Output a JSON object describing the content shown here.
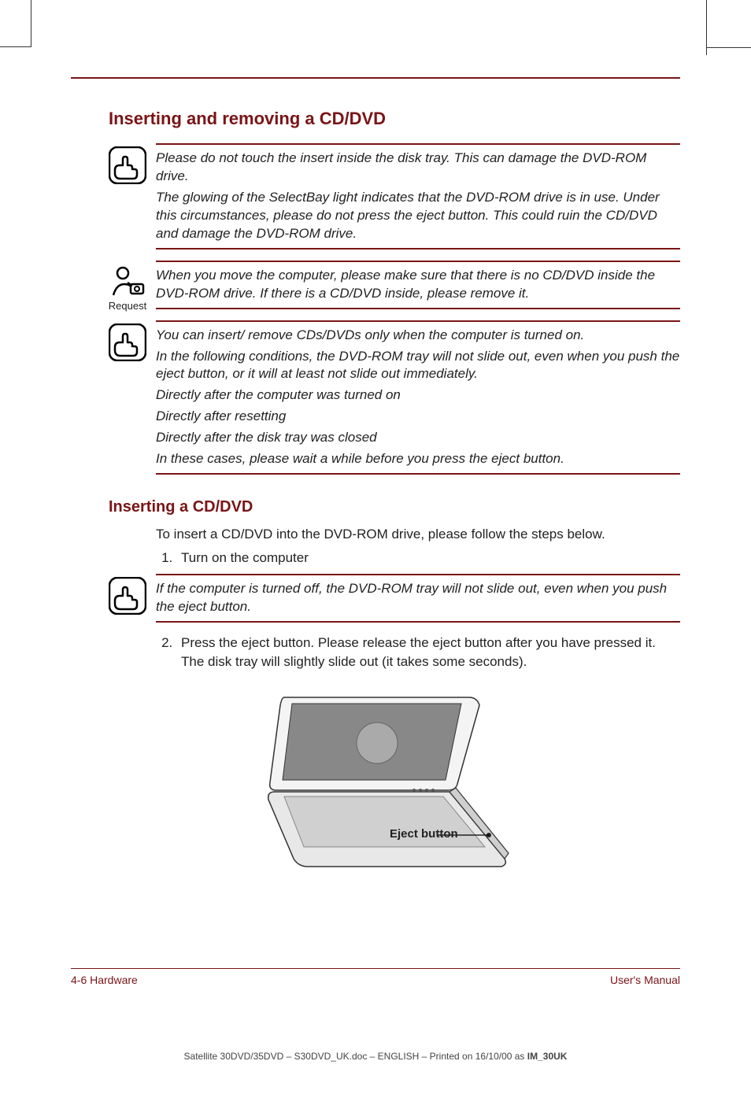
{
  "section": {
    "title_1": "Inserting and removing a CD/DVD",
    "title_2": "Inserting a CD/DVD"
  },
  "callouts": {
    "c1": {
      "p1": "Please do not touch the insert inside the disk tray. This can damage the DVD-ROM drive.",
      "p2": "The glowing of the SelectBay light indicates that the DVD-ROM drive is in use. Under this circumstances, please do not press the eject button. This could ruin the CD/DVD and damage the DVD-ROM drive."
    },
    "c2": {
      "label": "Request",
      "p1": "When you move the computer, please make sure that there is no CD/DVD inside the DVD-ROM drive. If there is a CD/DVD inside, please remove it."
    },
    "c3": {
      "p1": "You can insert/ remove CDs/DVDs only when the computer is turned on.",
      "p2": "In the following conditions, the DVD-ROM tray will not slide out, even when you push the eject button, or it will at least not slide out immediately.",
      "p3": "Directly after the computer was turned on",
      "p4": "Directly after resetting",
      "p5": "Directly after the disk tray was closed",
      "p6": "In these cases, please wait a while before you press the eject button."
    },
    "c4": {
      "p1": "If the computer is turned off, the DVD-ROM tray will not slide out, even when you push the eject button."
    }
  },
  "body": {
    "intro": "To insert a CD/DVD into the DVD-ROM drive, please follow the steps below.",
    "step1": "Turn on the computer",
    "step2": "Press the eject button. Please release the eject button after you have pressed it. The disk tray will slightly slide out (it takes some seconds)."
  },
  "figure": {
    "label": "Eject button"
  },
  "footer": {
    "left": "4-6  Hardware",
    "right": "User's Manual"
  },
  "printline": {
    "prefix": "Satellite 30DVD/35DVD  – S30DVD_UK.doc – ENGLISH – Printed on 16/10/00 as ",
    "bold": "IM_30UK"
  }
}
